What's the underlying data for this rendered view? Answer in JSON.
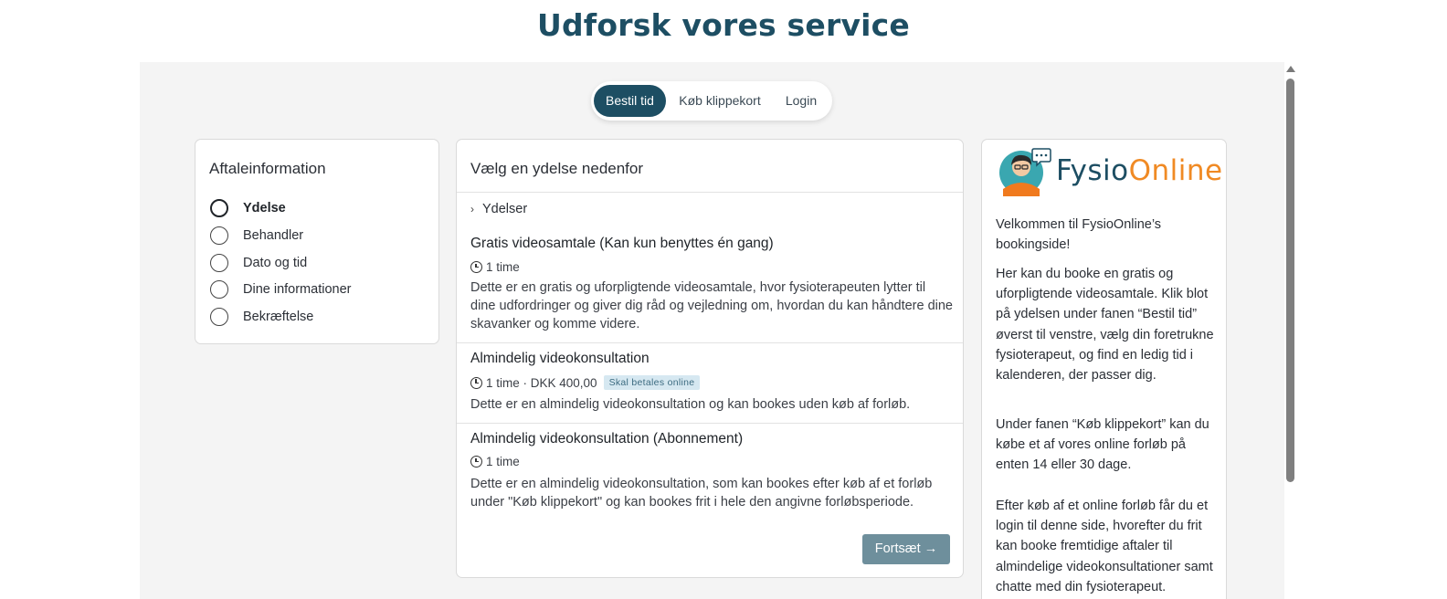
{
  "page": {
    "title": "Udforsk vores service"
  },
  "tabs": [
    {
      "label": "Bestil tid",
      "active": true
    },
    {
      "label": "Køb klippekort",
      "active": false
    },
    {
      "label": "Login",
      "active": false
    }
  ],
  "appointment": {
    "title": "Aftaleinformation",
    "steps": [
      {
        "label": "Ydelse",
        "current": true
      },
      {
        "label": "Behandler",
        "current": false
      },
      {
        "label": "Dato og tid",
        "current": false
      },
      {
        "label": "Dine informationer",
        "current": false
      },
      {
        "label": "Bekræftelse",
        "current": false
      }
    ]
  },
  "services": {
    "title": "Vælg en ydelse nedenfor",
    "crumb": "Ydelser",
    "items": [
      {
        "title": "Gratis videosamtale (Kan kun benyttes én gang)",
        "meta": "1 time",
        "badge": "",
        "desc": "Dette er en gratis og uforpligtende videosamtale, hvor fysioterapeuten lytter til dine udfordringer og giver dig råd og vejledning om, hvordan du kan håndtere dine skavanker og komme videre."
      },
      {
        "title": "Almindelig videokonsultation",
        "meta": "1 time · DKK 400,00",
        "badge": "Skal betales online",
        "desc": "Dette er en almindelig videokonsultation og kan bookes uden køb af forløb."
      },
      {
        "title": "Almindelig videokonsultation (Abonnement)",
        "meta": "1 time",
        "badge": "",
        "desc": "Dette er en almindelig videokonsultation, som kan bookes efter køb af et forløb under \"Køb klippekort\" og kan bookes frit i hele den angivne forløbsperiode."
      }
    ],
    "continue_label": "Fortsæt",
    "continue_arrow": "→"
  },
  "info": {
    "logo_part1": "Fysio",
    "logo_part2": "Online",
    "paragraphs": [
      "Velkommen til FysioOnline’s bookingside!",
      "Her kan du booke en gratis og uforpligtende videosamtale. Klik blot på ydelsen under fanen “Bestil tid” øverst til venstre, vælg din foretrukne fysioterapeut, og find en ledig tid i kalenderen, der passer dig.",
      "Under fanen “Køb klippekort” kan du købe et af vores online forløb på enten 14 eller 30 dage.",
      "Efter køb af et online forløb får du et login til denne side, hvorefter du frit kan booke fremtidige aftaler til almindelige videokonsultationer samt chatte med din fysioterapeut."
    ]
  },
  "colors": {
    "brand_primary": "#1d4e63",
    "brand_accent": "#f08a24",
    "button": "#6e8f9c",
    "badge_bg": "#d6e8f1"
  }
}
